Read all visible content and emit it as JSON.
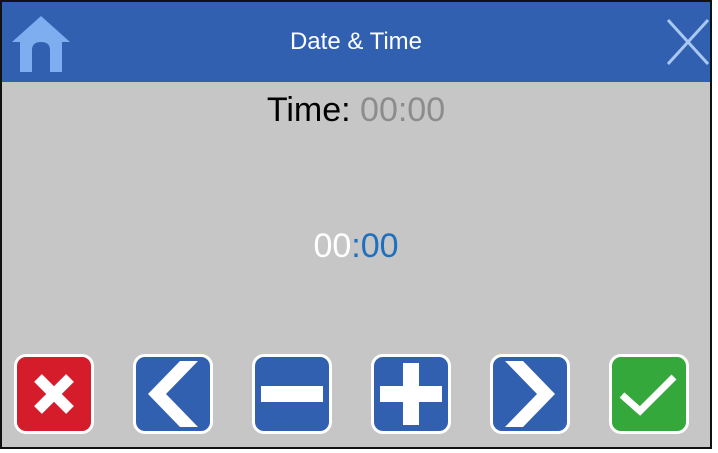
{
  "header": {
    "title": "Date & Time",
    "color": "#3160b0"
  },
  "time_display": {
    "label": "Time:",
    "current_value": "00:00"
  },
  "editor": {
    "hours": "00",
    "separator": ":",
    "minutes": "00",
    "active_field": "minutes"
  },
  "buttons": [
    {
      "name": "cancel",
      "icon": "x-icon",
      "color": "#d41c2a"
    },
    {
      "name": "previous",
      "icon": "chevron-left-icon",
      "color": "#3160b0"
    },
    {
      "name": "decrement",
      "icon": "minus-icon",
      "color": "#3160b0"
    },
    {
      "name": "increment",
      "icon": "plus-icon",
      "color": "#3160b0"
    },
    {
      "name": "next",
      "icon": "chevron-right-icon",
      "color": "#3160b0"
    },
    {
      "name": "confirm",
      "icon": "checkmark-icon",
      "color": "#35a83b"
    }
  ],
  "colors": {
    "background": "#c6c6c6",
    "header": "#3160b0",
    "home_icon": "#7eaef0",
    "active_digits": "#1d6fbf",
    "inactive_digits": "#ffffff",
    "current_value": "#8c8c8c"
  }
}
